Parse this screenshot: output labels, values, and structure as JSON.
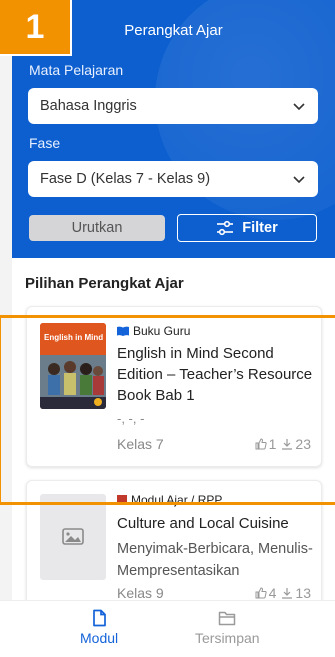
{
  "badge": "1",
  "header": {
    "title": "Perangkat Ajar",
    "subject_label": "Mata Pelajaran",
    "subject_value": "Bahasa Inggris",
    "phase_label": "Fase",
    "phase_value": "Fase D (Kelas 7 - Kelas 9)",
    "sort_label": "Urutkan",
    "filter_label": "Filter"
  },
  "section_title": "Pilihan Perangkat Ajar",
  "cards": [
    {
      "type": "Buku Guru",
      "title": "English in Mind Second Edition – Teacher’s Resource Book Bab 1",
      "subtitle": "-, -, -",
      "kelas": "Kelas 7",
      "likes": "1",
      "downloads": "23",
      "thumb_title": "English in Mind"
    },
    {
      "type": "Modul Ajar / RPP",
      "title": "Culture and Local Cuisine",
      "subtitle": "Menyimak-Berbicara, Menulis-Mempresentasikan",
      "kelas": "Kelas 9",
      "likes": "4",
      "downloads": "13"
    }
  ],
  "nav": {
    "modul": "Modul",
    "tersimpan": "Tersimpan"
  },
  "colors": {
    "primary": "#0d5fcf",
    "highlight": "#f39200",
    "active_nav": "#1463d9",
    "inactive_nav": "#9a9a9a"
  }
}
